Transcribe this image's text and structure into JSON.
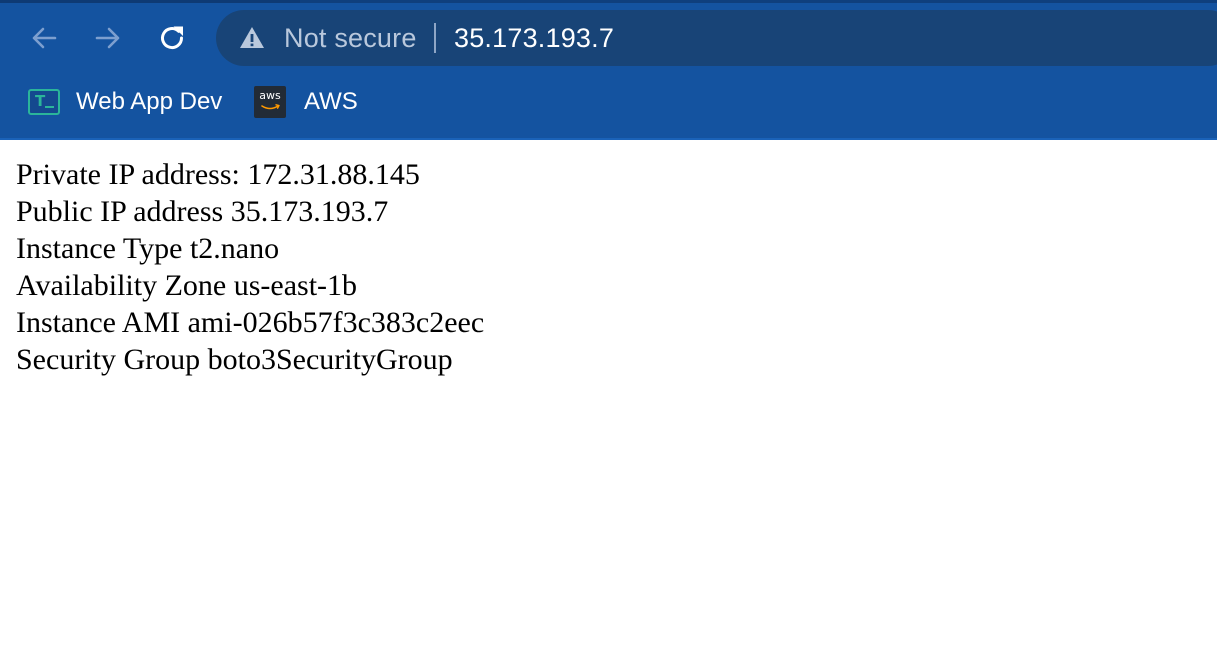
{
  "colors": {
    "chrome_bg": "#1453a0",
    "omnibox_bg": "#184477",
    "url_text": "#ffffff",
    "security_text": "#b9c8dc",
    "nav_icon_dim": "#7d9fcf",
    "nav_icon_active": "#ffffff",
    "webapp_icon_accent": "#2bb59a",
    "aws_icon_bg": "#222b36",
    "page_bg": "#ffffff",
    "page_text": "#000000"
  },
  "toolbar": {
    "back_icon": "arrow-left-icon",
    "forward_icon": "arrow-right-icon",
    "reload_icon": "reload-icon",
    "security_icon": "warning-triangle-icon",
    "security_label": "Not secure",
    "url": "35.173.193.7"
  },
  "bookmarks": [
    {
      "label": "Web App Dev",
      "icon": "terminal-icon",
      "icon_text": "T"
    },
    {
      "label": "AWS",
      "icon": "aws-icon",
      "icon_text": "aws"
    }
  ],
  "page": {
    "lines": [
      "Private IP address: 172.31.88.145",
      "Public IP address 35.173.193.7",
      "Instance Type t2.nano",
      "Availability Zone us-east-1b",
      "Instance AMI ami-026b57f3c383c2eec",
      "Security Group boto3SecurityGroup"
    ]
  }
}
